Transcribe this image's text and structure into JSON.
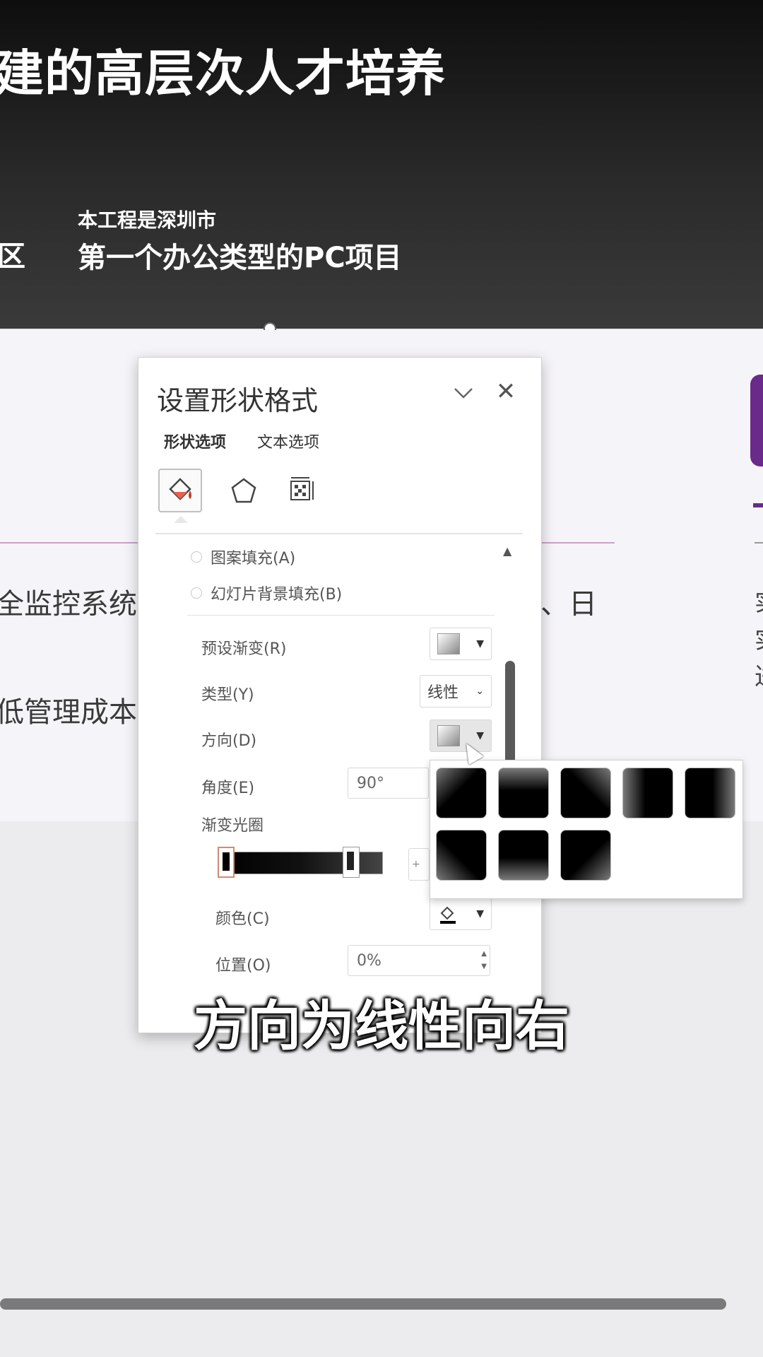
{
  "slide": {
    "title": "建的高层次人才培养",
    "sub_left": "区",
    "sub_small": "本工程是深圳市",
    "sub_big": "第一个办公类型的PC项目",
    "body_line1_left": "全监控系统",
    "body_line1_right": "、日",
    "body_line2_left": "低管理成本",
    "right_line1": "实",
    "right_line2": "实",
    "right_line3": "进"
  },
  "pane": {
    "title": "设置形状格式",
    "tabs": [
      "形状选项",
      "文本选项"
    ],
    "icon_tabs": [
      "fill-line-icon",
      "effects-pentagon-icon",
      "size-properties-icon"
    ],
    "fill_options": [
      "图案填充(A)",
      "幻灯片背景填充(B)"
    ],
    "props": {
      "preset_label": "预设渐变(R)",
      "type_label": "类型(Y)",
      "type_value": "线性",
      "direction_label": "方向(D)",
      "angle_label": "角度(E)",
      "angle_value": "90°",
      "stops_label": "渐变光圈",
      "color_label": "颜色(C)",
      "position_label": "位置(O)",
      "position_value": "0%"
    }
  },
  "direction_gallery": {
    "count": 8,
    "note_colors": [
      "#000000",
      "#5a5a5a"
    ]
  },
  "subtitle": "方向为线性向右"
}
